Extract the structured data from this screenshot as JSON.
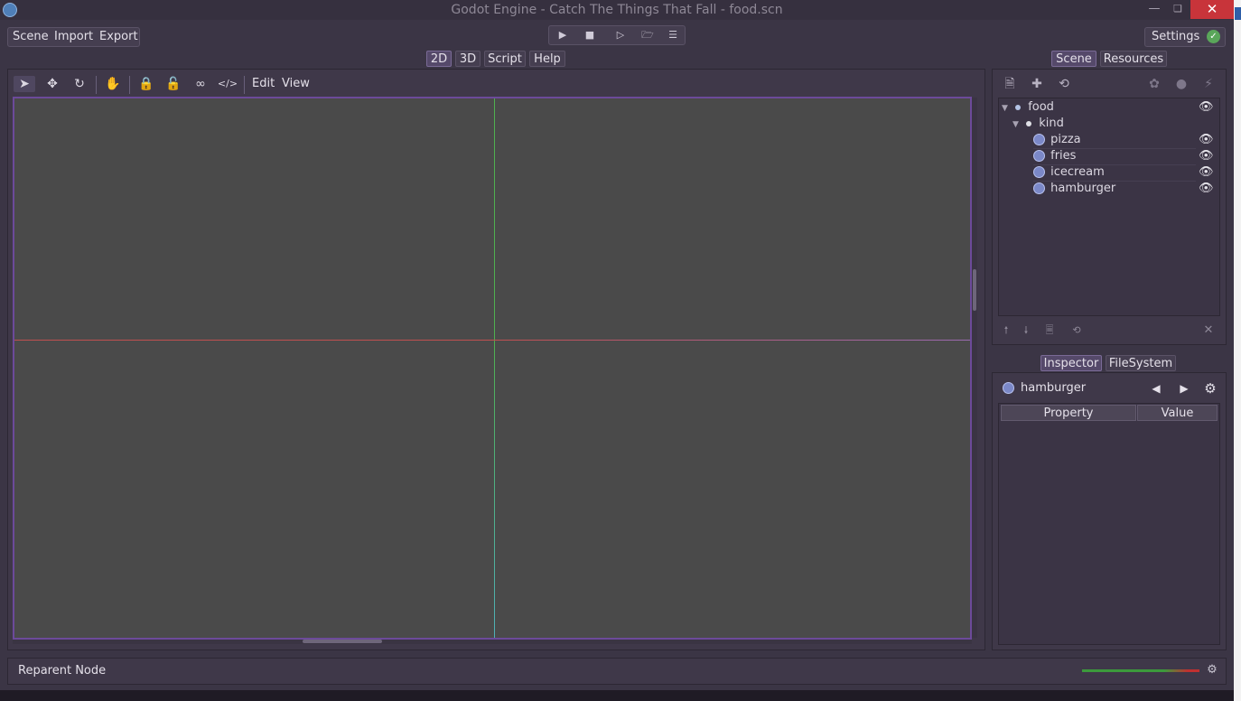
{
  "window": {
    "title": "Godot Engine - Catch The Things That Fall - food.scn",
    "app_icon": "godot-icon"
  },
  "menu": {
    "scene": "Scene",
    "import": "Import",
    "export": "Export"
  },
  "play_controls": [
    "play-icon",
    "stop-icon",
    "play-scene-icon",
    "folder-icon",
    "list-icon"
  ],
  "settings": {
    "label": "Settings"
  },
  "main_tabs": {
    "tab_2d": "2D",
    "tab_3d": "3D",
    "tab_script": "Script",
    "tab_help": "Help",
    "active": "2D"
  },
  "viewport": {
    "edit_menu": "Edit",
    "view_menu": "View",
    "tools": [
      "select-icon",
      "move-icon",
      "rotate-icon",
      "pan-icon",
      "lock-icon",
      "unlock-icon",
      "group-icon",
      "ungroup-icon"
    ]
  },
  "scene_dock": {
    "tab_scene": "Scene",
    "tab_resources": "Resources",
    "tree": {
      "root": "food",
      "group": "kind",
      "items": [
        "pizza",
        "fries",
        "icecream",
        "hamburger"
      ]
    }
  },
  "inspector": {
    "tab_inspector": "Inspector",
    "tab_filesystem": "FileSystem",
    "node_name": "hamburger",
    "col_property": "Property",
    "col_value": "Value"
  },
  "status": {
    "text": "Reparent Node"
  },
  "colors": {
    "accent": "#6c4a9a",
    "close": "#c8343a",
    "panel": "#3f3849"
  }
}
